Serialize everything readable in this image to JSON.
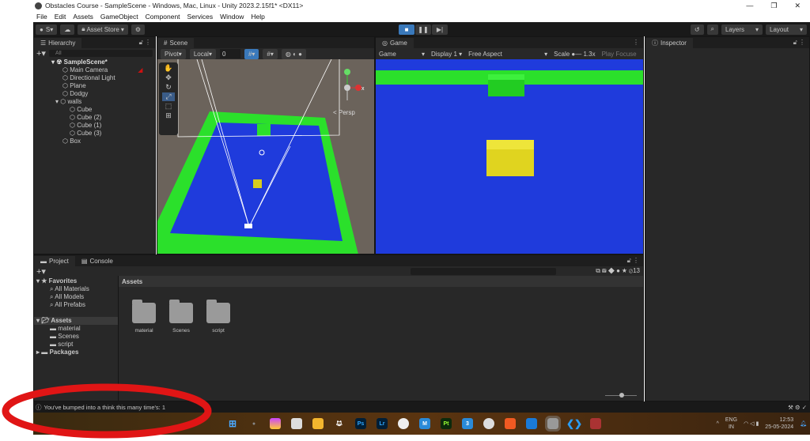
{
  "window": {
    "title": "Obstacles Course - SampleScene - Windows, Mac, Linux - Unity 2023.2.15f1* <DX11>",
    "minimize": "—",
    "maximize": "❐",
    "close": "✕"
  },
  "menu": [
    "File",
    "Edit",
    "Assets",
    "GameObject",
    "Component",
    "Services",
    "Window",
    "Help"
  ],
  "toolbar": {
    "account": "S",
    "asset_store": "Asset Store",
    "layers": "Layers",
    "layout": "Layout"
  },
  "hierarchy": {
    "tab": "Hierarchy",
    "search_placeholder": "All",
    "scene": "SampleScene*",
    "items": [
      "Main Camera",
      "Directional Light",
      "Plane",
      "Dodgy",
      "walls",
      "Cube",
      "Cube (2)",
      "Cube (1)",
      "Cube (3)",
      "Box"
    ]
  },
  "scene": {
    "tab": "Scene",
    "pivot": "Pivot",
    "local": "Local",
    "snap": "0",
    "persp": "< Persp",
    "gizmo_x": "x"
  },
  "game": {
    "tab": "Game",
    "mode": "Game",
    "display": "Display 1",
    "aspect": "Free Aspect",
    "scale_label": "Scale",
    "scale": "1.3x",
    "play_focused": "Play Focused"
  },
  "inspector": {
    "tab": "Inspector"
  },
  "project": {
    "tab_project": "Project",
    "tab_console": "Console",
    "favorites": "Favorites",
    "fav_items": [
      "All Materials",
      "All Models",
      "All Prefabs"
    ],
    "assets": "Assets",
    "asset_items": [
      "material",
      "Scenes",
      "script"
    ],
    "packages": "Packages",
    "breadcrumb": "Assets",
    "folders": [
      "material",
      "Scenes",
      "script"
    ],
    "hidden_count": "13"
  },
  "status": {
    "message": "You've bumped into a think this many time's: 1"
  },
  "taskbar": {
    "lang": "ENG",
    "region": "IN",
    "time": "12:53",
    "date": "25-05-2024",
    "apps": [
      "Ps",
      "Lr",
      "M",
      "Pt",
      "3"
    ]
  },
  "colors": {
    "accent": "#3a79bb",
    "ground": "#1f3bdc",
    "wall": "#2be02b",
    "box": "#e0d41f",
    "annotation": "#e01515"
  }
}
